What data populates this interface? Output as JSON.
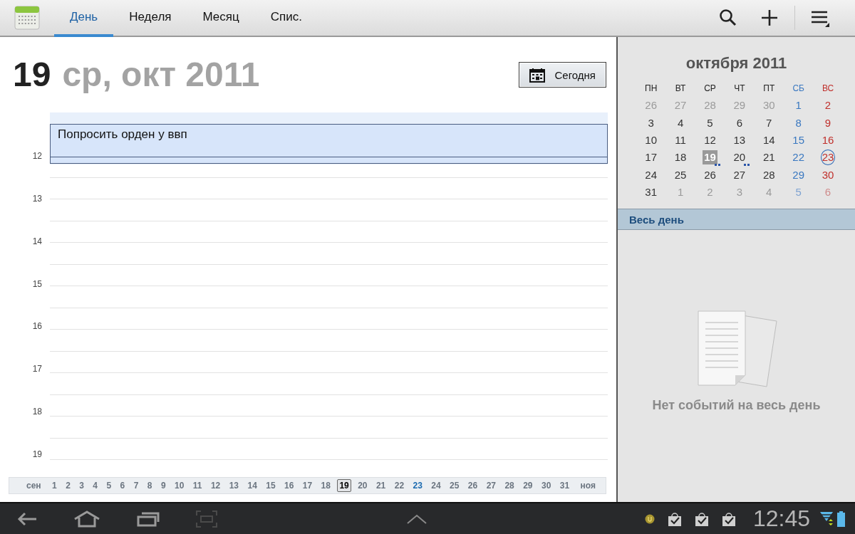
{
  "tabs": [
    {
      "label": "День",
      "selected": true
    },
    {
      "label": "Неделя",
      "selected": false
    },
    {
      "label": "Месяц",
      "selected": false
    },
    {
      "label": "Спис.",
      "selected": false
    }
  ],
  "day_view": {
    "day_number": "19",
    "date_rest": "ср, окт 2011",
    "today_button": "Сегодня",
    "hours": [
      "12",
      "13",
      "14",
      "15",
      "16",
      "17",
      "18",
      "19"
    ],
    "event": {
      "title": "Попросить орден у ввп"
    },
    "day_strip": [
      {
        "label": "сен",
        "kind": "month",
        "selected": false,
        "highlighted": false
      },
      {
        "label": "1",
        "kind": "day",
        "selected": false,
        "highlighted": false
      },
      {
        "label": "2",
        "kind": "day",
        "selected": false,
        "highlighted": false
      },
      {
        "label": "3",
        "kind": "day",
        "selected": false,
        "highlighted": false
      },
      {
        "label": "4",
        "kind": "day",
        "selected": false,
        "highlighted": false
      },
      {
        "label": "5",
        "kind": "day",
        "selected": false,
        "highlighted": false
      },
      {
        "label": "6",
        "kind": "day",
        "selected": false,
        "highlighted": false
      },
      {
        "label": "7",
        "kind": "day",
        "selected": false,
        "highlighted": false
      },
      {
        "label": "8",
        "kind": "day",
        "selected": false,
        "highlighted": false
      },
      {
        "label": "9",
        "kind": "day",
        "selected": false,
        "highlighted": false
      },
      {
        "label": "10",
        "kind": "day",
        "selected": false,
        "highlighted": false
      },
      {
        "label": "11",
        "kind": "day",
        "selected": false,
        "highlighted": false
      },
      {
        "label": "12",
        "kind": "day",
        "selected": false,
        "highlighted": false
      },
      {
        "label": "13",
        "kind": "day",
        "selected": false,
        "highlighted": false
      },
      {
        "label": "14",
        "kind": "day",
        "selected": false,
        "highlighted": false
      },
      {
        "label": "15",
        "kind": "day",
        "selected": false,
        "highlighted": false
      },
      {
        "label": "16",
        "kind": "day",
        "selected": false,
        "highlighted": false
      },
      {
        "label": "17",
        "kind": "day",
        "selected": false,
        "highlighted": false
      },
      {
        "label": "18",
        "kind": "day",
        "selected": false,
        "highlighted": false
      },
      {
        "label": "19",
        "kind": "day",
        "selected": true,
        "highlighted": false
      },
      {
        "label": "20",
        "kind": "day",
        "selected": false,
        "highlighted": false
      },
      {
        "label": "21",
        "kind": "day",
        "selected": false,
        "highlighted": false
      },
      {
        "label": "22",
        "kind": "day",
        "selected": false,
        "highlighted": false
      },
      {
        "label": "23",
        "kind": "day",
        "selected": false,
        "highlighted": true
      },
      {
        "label": "24",
        "kind": "day",
        "selected": false,
        "highlighted": false
      },
      {
        "label": "25",
        "kind": "day",
        "selected": false,
        "highlighted": false
      },
      {
        "label": "26",
        "kind": "day",
        "selected": false,
        "highlighted": false
      },
      {
        "label": "27",
        "kind": "day",
        "selected": false,
        "highlighted": false
      },
      {
        "label": "28",
        "kind": "day",
        "selected": false,
        "highlighted": false
      },
      {
        "label": "29",
        "kind": "day",
        "selected": false,
        "highlighted": false
      },
      {
        "label": "30",
        "kind": "day",
        "selected": false,
        "highlighted": false
      },
      {
        "label": "31",
        "kind": "day",
        "selected": false,
        "highlighted": false
      },
      {
        "label": "ноя",
        "kind": "month",
        "selected": false,
        "highlighted": false
      }
    ]
  },
  "mini_calendar": {
    "title": "октября 2011",
    "weekdays": [
      {
        "label": "ПН",
        "kind": "weekday"
      },
      {
        "label": "ВТ",
        "kind": "weekday"
      },
      {
        "label": "СР",
        "kind": "weekday"
      },
      {
        "label": "ЧТ",
        "kind": "weekday"
      },
      {
        "label": "ПТ",
        "kind": "weekday"
      },
      {
        "label": "СБ",
        "kind": "saturday"
      },
      {
        "label": "ВС",
        "kind": "sunday"
      }
    ],
    "weeks": [
      [
        {
          "label": "26",
          "other_month": true,
          "selected": false,
          "today": false,
          "has_events": false
        },
        {
          "label": "27",
          "other_month": true,
          "selected": false,
          "today": false,
          "has_events": false
        },
        {
          "label": "28",
          "other_month": true,
          "selected": false,
          "today": false,
          "has_events": false
        },
        {
          "label": "29",
          "other_month": true,
          "selected": false,
          "today": false,
          "has_events": false
        },
        {
          "label": "30",
          "other_month": true,
          "selected": false,
          "today": false,
          "has_events": false
        },
        {
          "label": "1",
          "other_month": false,
          "selected": false,
          "today": false,
          "has_events": false
        },
        {
          "label": "2",
          "other_month": false,
          "selected": false,
          "today": false,
          "has_events": false
        }
      ],
      [
        {
          "label": "3",
          "other_month": false,
          "selected": false,
          "today": false,
          "has_events": false
        },
        {
          "label": "4",
          "other_month": false,
          "selected": false,
          "today": false,
          "has_events": false
        },
        {
          "label": "5",
          "other_month": false,
          "selected": false,
          "today": false,
          "has_events": false
        },
        {
          "label": "6",
          "other_month": false,
          "selected": false,
          "today": false,
          "has_events": false
        },
        {
          "label": "7",
          "other_month": false,
          "selected": false,
          "today": false,
          "has_events": false
        },
        {
          "label": "8",
          "other_month": false,
          "selected": false,
          "today": false,
          "has_events": false
        },
        {
          "label": "9",
          "other_month": false,
          "selected": false,
          "today": false,
          "has_events": false
        }
      ],
      [
        {
          "label": "10",
          "other_month": false,
          "selected": false,
          "today": false,
          "has_events": false
        },
        {
          "label": "11",
          "other_month": false,
          "selected": false,
          "today": false,
          "has_events": false
        },
        {
          "label": "12",
          "other_month": false,
          "selected": false,
          "today": false,
          "has_events": false
        },
        {
          "label": "13",
          "other_month": false,
          "selected": false,
          "today": false,
          "has_events": false
        },
        {
          "label": "14",
          "other_month": false,
          "selected": false,
          "today": false,
          "has_events": false
        },
        {
          "label": "15",
          "other_month": false,
          "selected": false,
          "today": false,
          "has_events": false
        },
        {
          "label": "16",
          "other_month": false,
          "selected": false,
          "today": false,
          "has_events": false
        }
      ],
      [
        {
          "label": "17",
          "other_month": false,
          "selected": false,
          "today": false,
          "has_events": false
        },
        {
          "label": "18",
          "other_month": false,
          "selected": false,
          "today": false,
          "has_events": false
        },
        {
          "label": "19",
          "other_month": false,
          "selected": true,
          "today": false,
          "has_events": true
        },
        {
          "label": "20",
          "other_month": false,
          "selected": false,
          "today": false,
          "has_events": true
        },
        {
          "label": "21",
          "other_month": false,
          "selected": false,
          "today": false,
          "has_events": false
        },
        {
          "label": "22",
          "other_month": false,
          "selected": false,
          "today": false,
          "has_events": false
        },
        {
          "label": "23",
          "other_month": false,
          "selected": false,
          "today": true,
          "has_events": false
        }
      ],
      [
        {
          "label": "24",
          "other_month": false,
          "selected": false,
          "today": false,
          "has_events": false
        },
        {
          "label": "25",
          "other_month": false,
          "selected": false,
          "today": false,
          "has_events": false
        },
        {
          "label": "26",
          "other_month": false,
          "selected": false,
          "today": false,
          "has_events": false
        },
        {
          "label": "27",
          "other_month": false,
          "selected": false,
          "today": false,
          "has_events": false
        },
        {
          "label": "28",
          "other_month": false,
          "selected": false,
          "today": false,
          "has_events": false
        },
        {
          "label": "29",
          "other_month": false,
          "selected": false,
          "today": false,
          "has_events": false
        },
        {
          "label": "30",
          "other_month": false,
          "selected": false,
          "today": false,
          "has_events": false
        }
      ],
      [
        {
          "label": "31",
          "other_month": false,
          "selected": false,
          "today": false,
          "has_events": false
        },
        {
          "label": "1",
          "other_month": true,
          "selected": false,
          "today": false,
          "has_events": false
        },
        {
          "label": "2",
          "other_month": true,
          "selected": false,
          "today": false,
          "has_events": false
        },
        {
          "label": "3",
          "other_month": true,
          "selected": false,
          "today": false,
          "has_events": false
        },
        {
          "label": "4",
          "other_month": true,
          "selected": false,
          "today": false,
          "has_events": false
        },
        {
          "label": "5",
          "other_month": true,
          "selected": false,
          "today": false,
          "has_events": false
        },
        {
          "label": "6",
          "other_month": true,
          "selected": false,
          "today": false,
          "has_events": false
        }
      ]
    ]
  },
  "all_day": {
    "header": "Весь день",
    "empty_text": "Нет событий на весь день"
  },
  "status_bar": {
    "time": "12:45"
  }
}
